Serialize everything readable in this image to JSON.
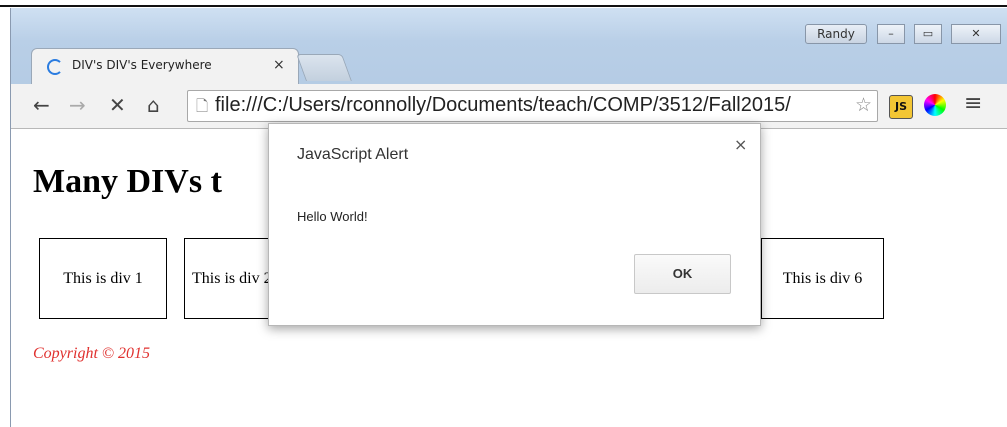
{
  "window": {
    "user": "Randy",
    "minimize_glyph": "–",
    "maximize_glyph": "▭",
    "close_glyph": "✕"
  },
  "tab": {
    "title": "DIV's DIV's Everywhere",
    "close": "×",
    "icon": "loading-spinner-icon"
  },
  "toolbar": {
    "back": "←",
    "forward": "→",
    "stop": "✕",
    "home": "⌂",
    "page_icon": "🗋",
    "url": "file:///C:/Users/rconnolly/Documents/teach/COMP/3512/Fall2015/",
    "star": "☆",
    "js_extension": "JS",
    "color_extension": "color-wheel-icon",
    "menu": "≡"
  },
  "page": {
    "heading": "Many DIVs t",
    "divs": [
      "This is div 1",
      "This is div 2",
      "This is div 6"
    ],
    "copyright": "Copyright © 2015"
  },
  "dialog": {
    "title": "JavaScript Alert",
    "close": "×",
    "message": "Hello World!",
    "ok_label": "OK"
  },
  "colors": {
    "accent": "#2a7ce0",
    "copyright": "#e0312f",
    "titlebar": "#c3d6ec"
  }
}
